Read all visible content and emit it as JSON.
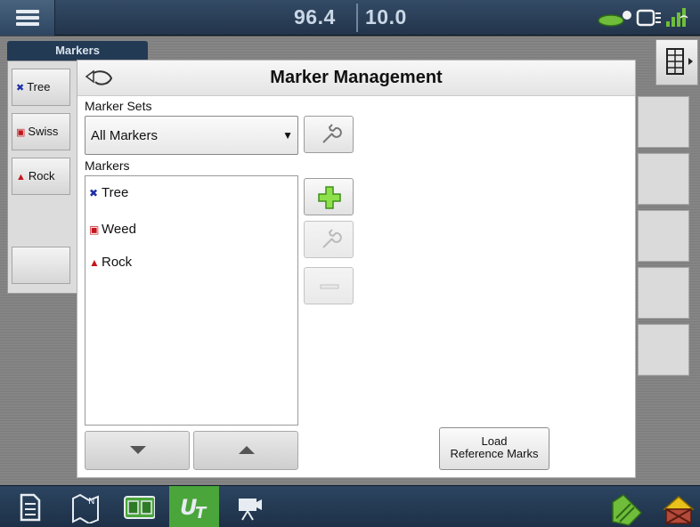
{
  "topbar": {
    "readout_a": "96.4",
    "readout_b": "10.0",
    "menu_icon": "hamburger-menu-icon",
    "status_icons": [
      "implement-icon",
      "display-link-icon",
      "gps-signal-icon"
    ]
  },
  "background": {
    "tab_label": "Markers",
    "side_buttons": [
      {
        "glyph": "✖",
        "glyph_color": "#1f2fa8",
        "label": "Tree"
      },
      {
        "glyph": "▣",
        "glyph_color": "#c4161c",
        "label": "Swiss"
      },
      {
        "glyph": "▲",
        "glyph_color": "#c4161c",
        "label": "Rock"
      }
    ]
  },
  "modal": {
    "title": "Marker Management",
    "marker_sets_label": "Marker Sets",
    "marker_set_selected": "All Markers",
    "markers_label": "Markers",
    "markers": [
      {
        "glyph": "✖",
        "glyph_color": "#1f2fa8",
        "label": "Tree"
      },
      {
        "glyph": "▣",
        "glyph_color": "#c4161c",
        "label": "Weed"
      },
      {
        "glyph": "▲",
        "glyph_color": "#c4161c",
        "label": "Rock"
      }
    ],
    "load_button_line1": "Load",
    "load_button_line2": "Reference Marks"
  },
  "bottombar": {
    "items": [
      "document-icon",
      "field-map-icon",
      "split-view-icon",
      "ut-icon",
      "camera-icon"
    ],
    "active_index": 3,
    "right_icons": [
      "coverage-icon",
      "no-coverage-icon"
    ]
  },
  "colors": {
    "accent_green": "#4aa53a",
    "header_blue": "#22344a"
  }
}
